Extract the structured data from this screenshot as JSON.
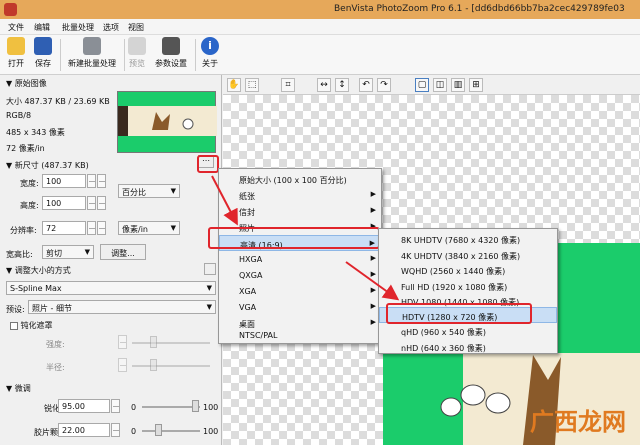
{
  "window": {
    "title": "BenVista PhotoZoom Pro 6.1 - [dd6dbd66bb7ba2cec429789fe03"
  },
  "menubar": [
    "文件",
    "编辑",
    "批量处理",
    "选项",
    "视图"
  ],
  "toolbar": {
    "open": "打开",
    "save": "保存",
    "batch": "新建批量处理",
    "preview": "预览",
    "params": "参数设置",
    "about": "关于"
  },
  "original": {
    "header": "原始图像",
    "size": "大小 487.37 KB / 23.69 KB",
    "mode": "RGB/8",
    "dims": "485 x 343 像素",
    "res": "72 像素/in"
  },
  "newsize": {
    "header": "新尺寸 (487.37 KB)",
    "width_label": "宽度:",
    "width_value": "100",
    "height_label": "高度:",
    "height_value": "100",
    "unit_percent": "百分比",
    "res_label": "分辨率:",
    "res_value": "72",
    "res_unit": "像素/in",
    "aspect_label": "宽高比:",
    "aspect_value": "剪切",
    "adjust_btn": "调整..."
  },
  "resize": {
    "header": "调整大小的方式",
    "method": "S-Spline Max",
    "preset_label": "预设:",
    "preset_value": "照片 - 细节",
    "sharpen_mask": "钝化遮罩",
    "strength_label": "强度:",
    "radius_label": "半径:",
    "fine_header": "微调",
    "sharp_label": "锐化:",
    "sharp_value": "95.00",
    "grain_label": "胶片颗粒:",
    "grain_value": "22.00",
    "min": "0",
    "max": "100"
  },
  "menu1": {
    "items": [
      "原始大小 (100 x 100 百分比)",
      "纸张",
      "信封",
      "照片",
      "高清 (16:9)",
      "HXGA",
      "QXGA",
      "XGA",
      "VGA",
      "桌面",
      "NTSC/PAL"
    ],
    "submenu_flags": [
      false,
      true,
      true,
      true,
      true,
      true,
      true,
      true,
      true,
      true,
      false
    ],
    "highlighted_index": 4
  },
  "menu2": {
    "items": [
      "8K UHDTV (7680 x 4320 像素)",
      "4K UHDTV (3840 x 2160 像素)",
      "WQHD (2560 x 1440 像素)",
      "Full HD (1920 x 1080 像素)",
      "HDV 1080 (1440 x 1080 像素)",
      "HDTV (1280 x 720 像素)",
      "qHD (960 x 540 像素)",
      "nHD (640 x 360 像素)"
    ],
    "highlighted_index": 5
  },
  "watermark": "广西龙网",
  "colors": {
    "accent_red": "#e0252c",
    "thumb_green": "#1bcc6b",
    "highlight": "#c9def5",
    "titlebar": "#e6a85a"
  }
}
